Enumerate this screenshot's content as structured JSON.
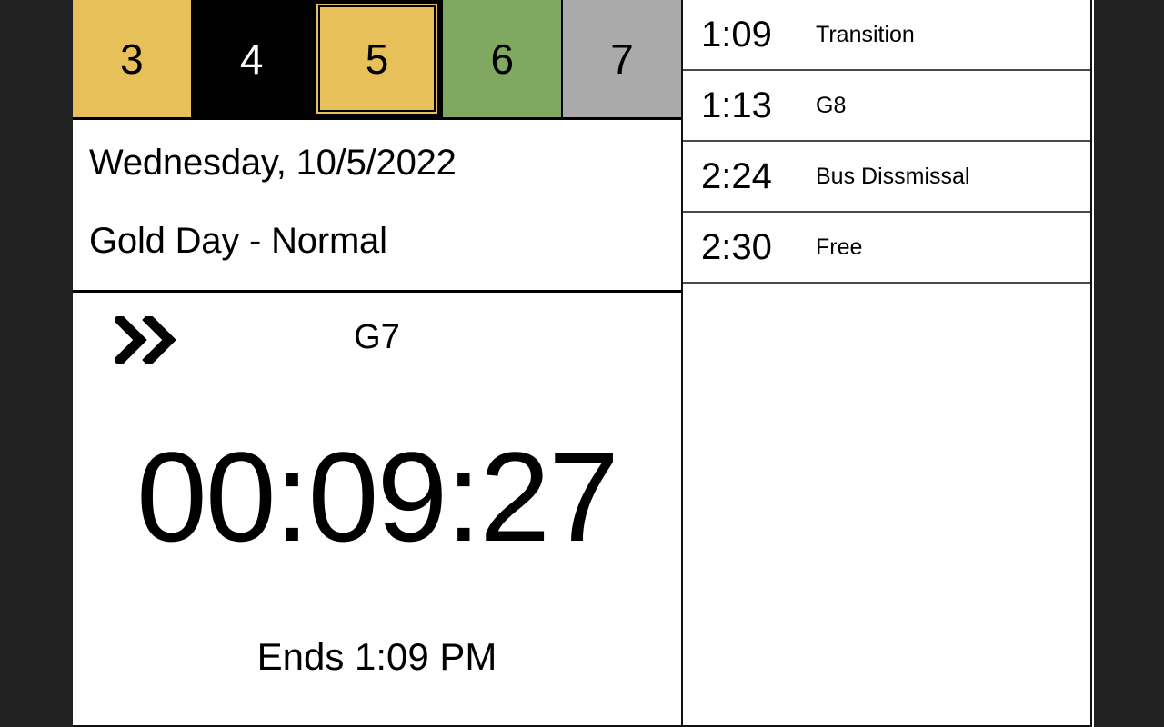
{
  "theme": {
    "page_background": "#212121",
    "panel_background": "#ffffff",
    "gold": "#e8c05a",
    "green": "#80a860",
    "gray": "#aaaaaa",
    "black": "#000000",
    "border": "#111111"
  },
  "period_tabs": [
    {
      "label": "3",
      "color": "#e8c05a",
      "text_color": "#000000",
      "selected": false
    },
    {
      "label": "4",
      "color": "#000000",
      "text_color": "#ffffff",
      "selected": false
    },
    {
      "label": "5",
      "color": "#e8c05a",
      "text_color": "#000000",
      "selected": true
    },
    {
      "label": "6",
      "color": "#80a860",
      "text_color": "#000000",
      "selected": false
    },
    {
      "label": "7",
      "color": "#aaaaaa",
      "text_color": "#000000",
      "selected": false
    }
  ],
  "day_banner": {
    "date": "Wednesday, 10/5/2022",
    "day_type": "Gold Day - Normal"
  },
  "timer": {
    "skip_icon": "double-chevron-right-icon",
    "current_period": "G7",
    "countdown": "00:09:27",
    "ends_label": "Ends 1:09 PM"
  },
  "schedule": {
    "rows": [
      {
        "time": "1:09",
        "name": "Transition"
      },
      {
        "time": "1:13",
        "name": "G8"
      },
      {
        "time": "2:24",
        "name": "Bus Dissmissal"
      },
      {
        "time": "2:30",
        "name": "Free"
      }
    ]
  }
}
